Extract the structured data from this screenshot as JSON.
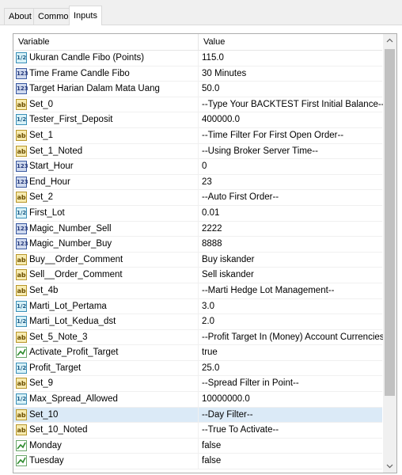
{
  "tabs": [
    {
      "label": "About"
    },
    {
      "label": "Common"
    },
    {
      "label": "Inputs"
    }
  ],
  "active_tab": "Inputs",
  "grid": {
    "columns": {
      "variable": "Variable",
      "value": "Value"
    },
    "rows": [
      {
        "type": "double",
        "icon_text": "1/2",
        "name": "Ukuran Candle Fibo (Points)",
        "value": "115.0"
      },
      {
        "type": "int",
        "icon_text": "123",
        "name": "Time Frame Candle Fibo",
        "value": "30 Minutes"
      },
      {
        "type": "int",
        "icon_text": "123",
        "name": "Target Harian Dalam Mata Uang",
        "value": "50.0"
      },
      {
        "type": "string",
        "icon_text": "ab",
        "name": "Set_0",
        "value": "--Type Your BACKTEST First Initial Balance--"
      },
      {
        "type": "double",
        "icon_text": "1/2",
        "name": "Tester_First_Deposit",
        "value": "400000.0"
      },
      {
        "type": "string",
        "icon_text": "ab",
        "name": "Set_1",
        "value": "--Time Filter For First Open Order--"
      },
      {
        "type": "string",
        "icon_text": "ab",
        "name": "Set_1_Noted",
        "value": "--Using Broker Server Time--"
      },
      {
        "type": "int",
        "icon_text": "123",
        "name": "Start_Hour",
        "value": "0"
      },
      {
        "type": "int",
        "icon_text": "123",
        "name": "End_Hour",
        "value": "23"
      },
      {
        "type": "string",
        "icon_text": "ab",
        "name": "Set_2",
        "value": "--Auto First Order--"
      },
      {
        "type": "double",
        "icon_text": "1/2",
        "name": "First_Lot",
        "value": "0.01"
      },
      {
        "type": "int",
        "icon_text": "123",
        "name": "Magic_Number_Sell",
        "value": "2222"
      },
      {
        "type": "int",
        "icon_text": "123",
        "name": "Magic_Number_Buy",
        "value": "8888"
      },
      {
        "type": "string",
        "icon_text": "ab",
        "name": "Buy__Order_Comment",
        "value": "Buy iskander"
      },
      {
        "type": "string",
        "icon_text": "ab",
        "name": "Sell__Order_Comment",
        "value": "Sell iskander"
      },
      {
        "type": "string",
        "icon_text": "ab",
        "name": "Set_4b",
        "value": "--Marti Hedge Lot Management--"
      },
      {
        "type": "double",
        "icon_text": "1/2",
        "name": "Marti_Lot_Pertama",
        "value": "3.0"
      },
      {
        "type": "double",
        "icon_text": "1/2",
        "name": "Marti_Lot_Kedua_dst",
        "value": "2.0"
      },
      {
        "type": "string",
        "icon_text": "ab",
        "name": "Set_5_Note_3",
        "value": "--Profit Target In (Money) Account Currencies--"
      },
      {
        "type": "bool",
        "icon_text": "",
        "name": "Activate_Profit_Target",
        "value": "true"
      },
      {
        "type": "double",
        "icon_text": "1/2",
        "name": "Profit_Target",
        "value": "25.0"
      },
      {
        "type": "string",
        "icon_text": "ab",
        "name": "Set_9",
        "value": "--Spread Filter in Point--"
      },
      {
        "type": "double",
        "icon_text": "1/2",
        "name": "Max_Spread_Allowed",
        "value": "10000000.0"
      },
      {
        "type": "string",
        "icon_text": "ab",
        "name": "Set_10",
        "value": "--Day Filter--",
        "selected": true
      },
      {
        "type": "string",
        "icon_text": "ab",
        "name": "Set_10_Noted",
        "value": "--True To Activate--"
      },
      {
        "type": "bool",
        "icon_text": "",
        "name": "Monday",
        "value": "false"
      },
      {
        "type": "bool",
        "icon_text": "",
        "name": "Tuesday",
        "value": "false"
      }
    ]
  },
  "scrollbar": {
    "up_glyph": "^",
    "down_glyph": "v"
  }
}
